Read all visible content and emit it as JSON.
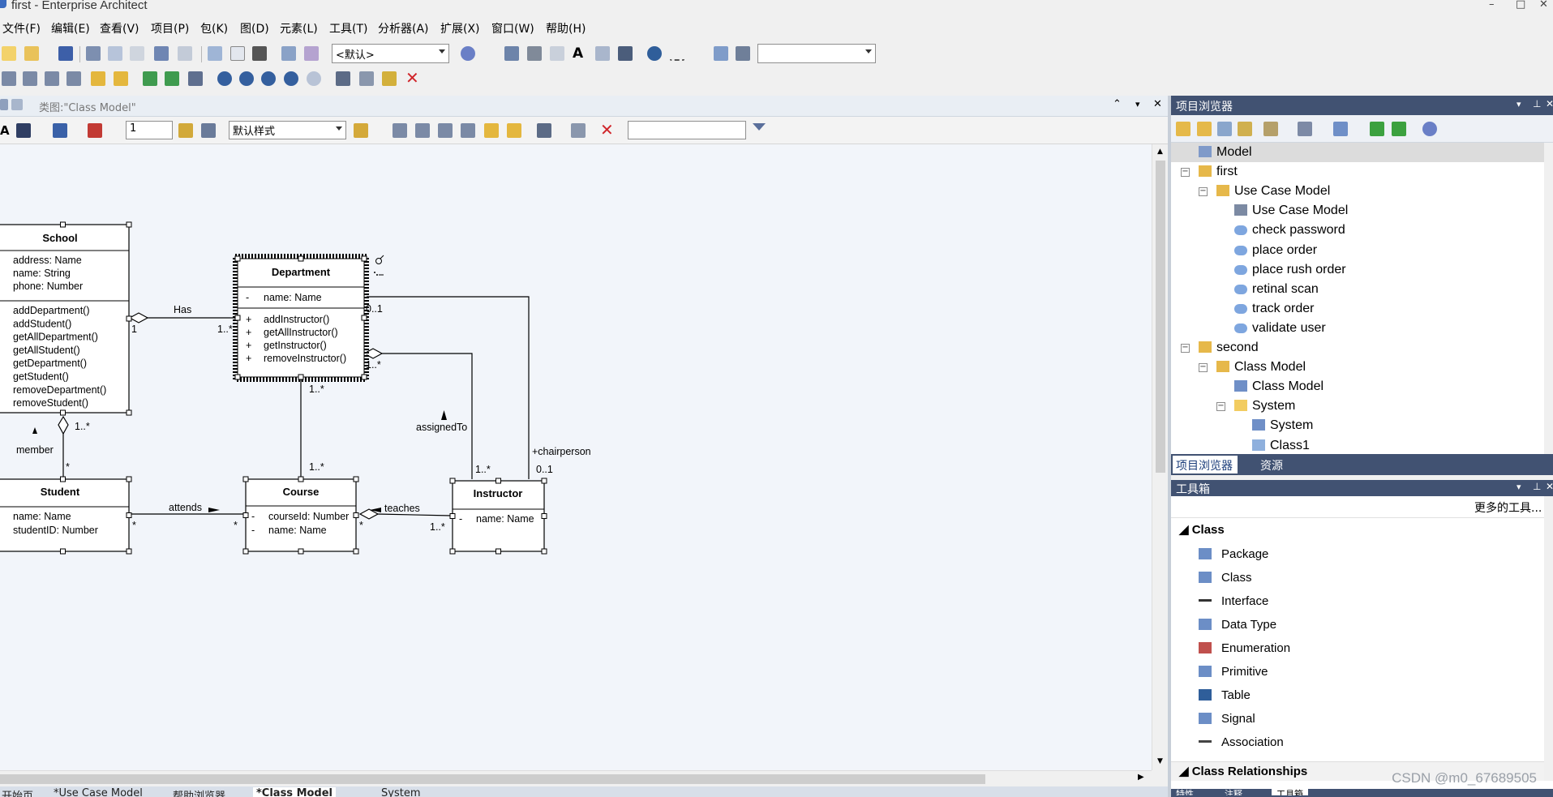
{
  "window": {
    "title": "first - Enterprise Architect",
    "minimize": "–",
    "maximize": "□",
    "close": "✕"
  },
  "menu": [
    "文件(F)",
    "编辑(E)",
    "查看(V)",
    "项目(P)",
    "包(K)",
    "图(D)",
    "元素(L)",
    "工具(T)",
    "分析器(A)",
    "扩展(X)",
    "窗口(W)",
    "帮助(H)"
  ],
  "toolbar": {
    "style_combo": "<默认>",
    "search_combo": ""
  },
  "diagram_tab": {
    "title": "类图:\"Class Model\""
  },
  "diagram_toolbar": {
    "line_width": "1",
    "style_combo": "默认样式",
    "filter_input": ""
  },
  "diagram": {
    "classes": {
      "school": {
        "name": "School",
        "attributes": [
          "address: Name",
          "name: String",
          "phone: Number"
        ],
        "operations": [
          "addDepartment()",
          "addStudent()",
          "getAllDepartment()",
          "getAllStudent()",
          "getDepartment()",
          "getStudent()",
          "removeDepartment()",
          "removeStudent()"
        ]
      },
      "department": {
        "name": "Department",
        "attr_vis": "-",
        "attributes": [
          "name: Name"
        ],
        "op_vis": "+",
        "operations": [
          "addInstructor()",
          "getAllInstructor()",
          "getInstructor()",
          "removeInstructor()"
        ]
      },
      "student": {
        "name": "Student",
        "attributes": [
          "name: Name",
          "studentID: Number"
        ]
      },
      "course": {
        "name": "Course",
        "attr_vis": "-",
        "attributes": [
          "courseId: Number",
          "name: Name"
        ]
      },
      "instructor": {
        "name": "Instructor",
        "attr_vis": "-",
        "attributes": [
          "name: Name"
        ]
      }
    },
    "labels": {
      "has": "Has",
      "has_mult_school": "1",
      "has_mult_dept": "1..*",
      "member": "member",
      "member_mult_school": "1..*",
      "member_mult_student": "*",
      "dept_course_mult_dept": "1..*",
      "dept_course_mult_course": "1..*",
      "attends": "attends",
      "attends_mult_student": "*",
      "attends_mult_course": "*",
      "teaches": "teaches",
      "teaches_mult_course": "*",
      "teaches_mult_instr": "1..*",
      "assigned_to": "assignedTo",
      "assigned_mult_dept": "1..*",
      "assigned_mult_instr": "1..*",
      "chairperson": "+chairperson",
      "chair_mult_dept": "0..1",
      "chair_mult_instr": "0..1"
    }
  },
  "project_browser": {
    "title": "项目浏览器",
    "tree": [
      {
        "label": "Model",
        "depth": 0,
        "icon": "model-icon",
        "expander": ""
      },
      {
        "label": "first",
        "depth": 0,
        "icon": "package-icon",
        "expander": "−"
      },
      {
        "label": "Use Case Model",
        "depth": 1,
        "icon": "package-icon",
        "expander": "−"
      },
      {
        "label": "Use Case Model",
        "depth": 2,
        "icon": "usecase-diagram-icon",
        "expander": ""
      },
      {
        "label": "check password",
        "depth": 2,
        "icon": "usecase-icon",
        "expander": ""
      },
      {
        "label": "place order",
        "depth": 2,
        "icon": "usecase-icon",
        "expander": ""
      },
      {
        "label": "place rush order",
        "depth": 2,
        "icon": "usecase-icon",
        "expander": ""
      },
      {
        "label": "retinal scan",
        "depth": 2,
        "icon": "usecase-icon",
        "expander": ""
      },
      {
        "label": "track order",
        "depth": 2,
        "icon": "usecase-icon",
        "expander": ""
      },
      {
        "label": "validate user",
        "depth": 2,
        "icon": "usecase-icon",
        "expander": ""
      },
      {
        "label": "second",
        "depth": 0,
        "icon": "package-icon",
        "expander": "−"
      },
      {
        "label": "Class Model",
        "depth": 1,
        "icon": "package-icon",
        "expander": "−"
      },
      {
        "label": "Class Model",
        "depth": 2,
        "icon": "class-diagram-icon",
        "expander": ""
      },
      {
        "label": "System",
        "depth": 2,
        "icon": "folder-icon",
        "expander": "−"
      },
      {
        "label": "System",
        "depth": 3,
        "icon": "class-diagram-icon",
        "expander": ""
      },
      {
        "label": "Class1",
        "depth": 3,
        "icon": "class-icon",
        "expander": ""
      }
    ],
    "tabs": [
      "项目浏览器",
      "资源"
    ]
  },
  "toolbox": {
    "title": "工具箱",
    "more_tools": "更多的工具...",
    "group_class": "Class",
    "items": [
      {
        "label": "Package",
        "icon": "package-tool-icon"
      },
      {
        "label": "Class",
        "icon": "class-tool-icon"
      },
      {
        "label": "Interface",
        "icon": "interface-tool-icon"
      },
      {
        "label": "Data Type",
        "icon": "datatype-tool-icon"
      },
      {
        "label": "Enumeration",
        "icon": "enumeration-tool-icon"
      },
      {
        "label": "Primitive",
        "icon": "primitive-tool-icon"
      },
      {
        "label": "Table",
        "icon": "table-tool-icon"
      },
      {
        "label": "Signal",
        "icon": "signal-tool-icon"
      },
      {
        "label": "Association",
        "icon": "association-tool-icon"
      }
    ],
    "group_relationships": "Class Relationships"
  },
  "bottom_tabs": [
    "开始页",
    "*Use Case Model",
    "帮助浏览器",
    "*Class Model",
    "System"
  ],
  "panel_bottom_tabs": [
    "特性",
    "注释",
    "工具箱"
  ],
  "watermark": "CSDN @m0_67689505",
  "colors": {
    "panel_header": "#415272",
    "canvas": "#f2f5fa",
    "class_fill": "#ffffff"
  }
}
